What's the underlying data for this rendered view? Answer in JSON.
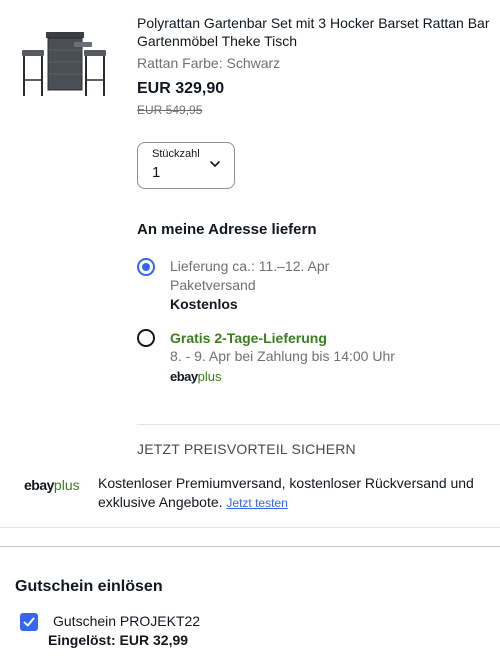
{
  "product": {
    "title": "Polyrattan Gartenbar Set mit 3 Hocker Barset Rattan Bar Gartenmöbel Theke Tisch",
    "variant": "Rattan Farbe: Schwarz",
    "price": "EUR 329,90",
    "original_price": "EUR 549,95"
  },
  "quantity": {
    "label": "Stückzahl",
    "value": "1"
  },
  "delivery": {
    "heading": "An meine Adresse liefern",
    "options": [
      {
        "selected": true,
        "line1": "Lieferung ca.: 11.–12. Apr",
        "line2": "Paketversand",
        "line3": "Kostenlos"
      },
      {
        "selected": false,
        "line1": "Gratis 2-Tage-Lieferung",
        "line2": "8. - 9. Apr bei Zahlung bis 14:00 Uhr",
        "badge_ebay": "ebay",
        "badge_plus": "plus"
      }
    ]
  },
  "promo": {
    "heading": "JETZT PREISVORTEIL SICHERN",
    "logo_ebay": "ebay",
    "logo_plus": "plus",
    "text": "Kostenloser Premiumversand, kostenloser Rückversand und exklusive Angebote.",
    "link": "Jetzt testen"
  },
  "voucher": {
    "heading": "Gutschein einlösen",
    "code_label": "Gutschein PROJEKT22",
    "redeemed": "Eingelöst: EUR 32,99",
    "checked": true
  },
  "colors": {
    "accent_blue": "#3665f3",
    "ebayplus_green": "#3a7e1d",
    "text_primary": "#111820",
    "text_secondary": "#707070"
  },
  "icons": {
    "product_image": "bar-set-image",
    "chevron": "chevron-down-icon",
    "check": "checkmark-icon"
  }
}
